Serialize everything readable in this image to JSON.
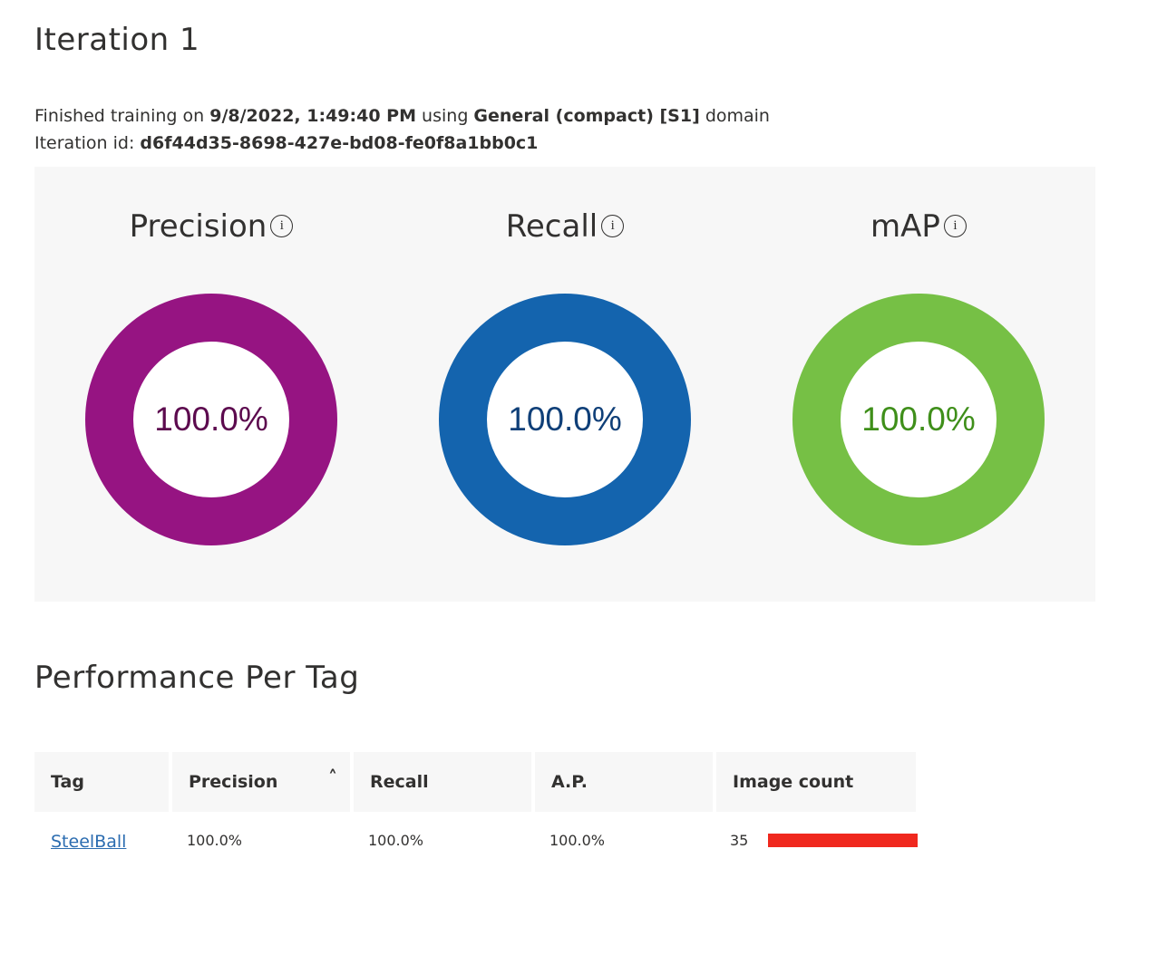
{
  "page": {
    "title": "Iteration 1",
    "meta_line1": {
      "prefix": "Finished training on ",
      "date": "9/8/2022, 1:49:40 PM",
      "middle": " using ",
      "domain_name": "General (compact) [S1]",
      "suffix": " domain"
    },
    "meta_line2": {
      "prefix": "Iteration id: ",
      "id": "d6f44d35-8698-427e-bd08-fe0f8a1bb0c1"
    }
  },
  "metrics": [
    {
      "title": "Precision",
      "value": "100.0%",
      "color": "#961482",
      "text_color": "#5c0a4e"
    },
    {
      "title": "Recall",
      "value": "100.0%",
      "color": "#1464ae",
      "text_color": "#0f3f78"
    },
    {
      "title": "mAP",
      "value": "100.0%",
      "color": "#76c045",
      "text_color": "#3f8f1a"
    }
  ],
  "info_icon_glyph": "i",
  "per_tag": {
    "title": "Performance Per Tag",
    "headers": [
      "Tag",
      "Precision",
      "Recall",
      "A.P.",
      "Image count"
    ],
    "sort_icon": "chevron-up-icon",
    "rows": [
      {
        "tag": "SteelBall",
        "precision": "100.0%",
        "recall": "100.0%",
        "ap": "100.0%",
        "image_count": "35",
        "bar_fraction": 1.0,
        "bar_color": "#f0281e"
      }
    ]
  }
}
